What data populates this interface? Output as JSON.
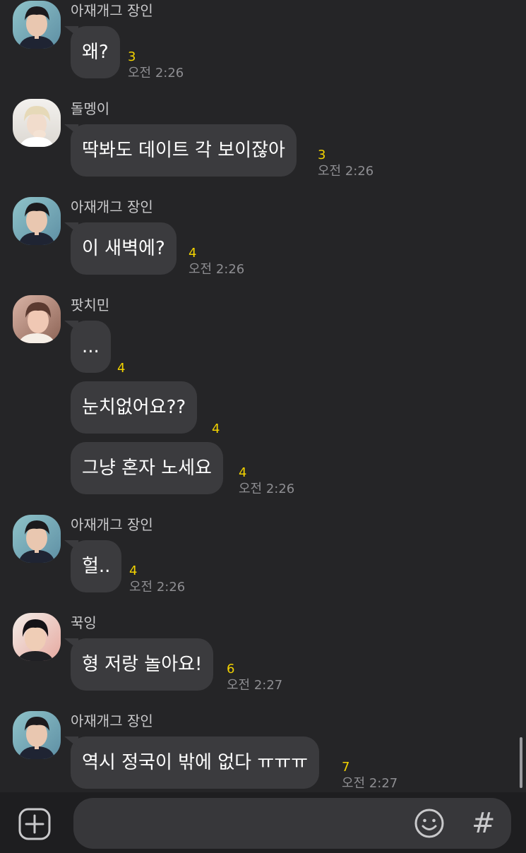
{
  "senders": {
    "jin": "아재개그 장인",
    "suga": "돌멩이",
    "jimin": "팟치민",
    "jungkook": "꾹잉"
  },
  "messages": [
    {
      "text": "왜?",
      "unread": "3",
      "time": "오전 2:26"
    },
    {
      "text": "딱봐도 데이트 각 보이잖아",
      "unread": "3",
      "time": "오전 2:26"
    },
    {
      "text": "이 새벽에?",
      "unread": "4",
      "time": "오전 2:26"
    },
    {
      "text": "...",
      "unread": "4"
    },
    {
      "text": "눈치없어요??",
      "unread": "4"
    },
    {
      "text": "그냥 혼자 노세요",
      "unread": "4",
      "time": "오전 2:26"
    },
    {
      "text": "헐..",
      "unread": "4",
      "time": "오전 2:26"
    },
    {
      "text": "형 저랑 놀아요!",
      "unread": "6",
      "time": "오전 2:27"
    },
    {
      "text": "역시 정국이 밖에 없다 ㅠㅠㅠ",
      "unread": "7",
      "time": "오전 2:27"
    }
  ],
  "composer": {
    "input_value": "",
    "hash_label": "#"
  },
  "colors": {
    "background": "#252527",
    "bubble": "#3b3b3e",
    "unread_count": "#f2d200",
    "timestamp": "#8e8e92",
    "sender_name": "#c9c9cb"
  },
  "icons": [
    "plus-icon",
    "emoji-icon",
    "hashtag-icon"
  ]
}
